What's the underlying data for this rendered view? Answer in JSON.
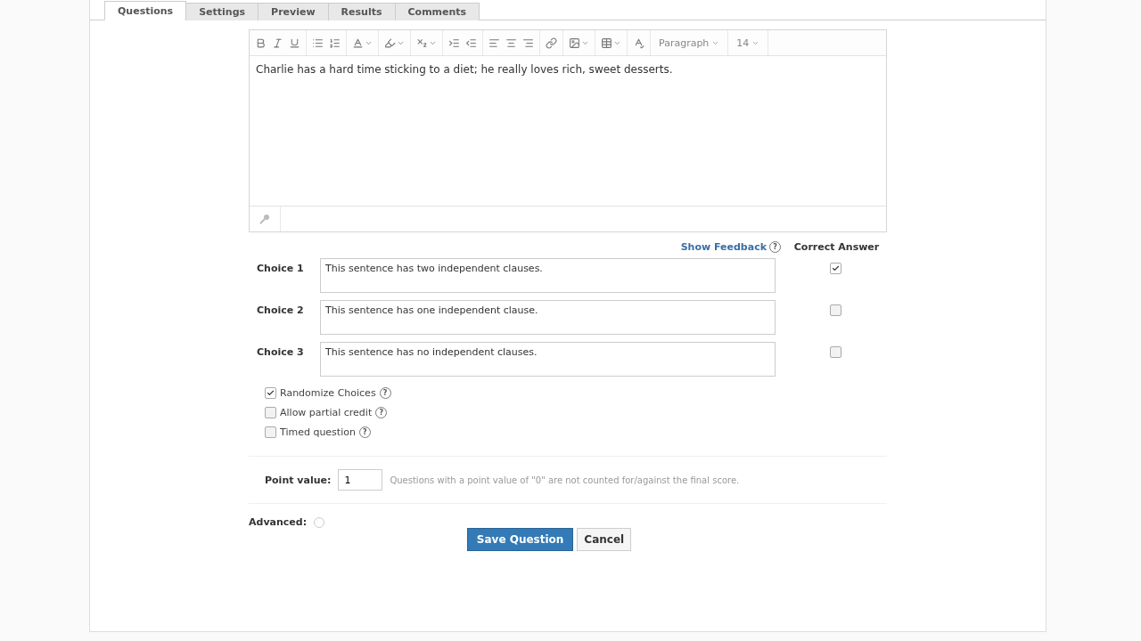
{
  "tabs": [
    {
      "label": "Questions",
      "selected": true
    },
    {
      "label": "Settings",
      "selected": false
    },
    {
      "label": "Preview",
      "selected": false
    },
    {
      "label": "Results",
      "selected": false
    },
    {
      "label": "Comments",
      "selected": false
    }
  ],
  "editor": {
    "format_dropdown": "Paragraph",
    "size_dropdown": "14",
    "content": "Charlie has a hard time sticking to a diet; he really loves rich, sweet desserts."
  },
  "show_feedback": "Show Feedback",
  "show_feedback_help": "?",
  "correct_answer_header": "Correct Answer",
  "choices": [
    {
      "label": "Choice 1",
      "value": "This sentence has two independent clauses.",
      "correct": true
    },
    {
      "label": "Choice 2",
      "value": "This sentence has one independent clause.",
      "correct": false
    },
    {
      "label": "Choice 3",
      "value": "This sentence has no independent clauses.",
      "correct": false
    }
  ],
  "options": [
    {
      "label": "Randomize Choices",
      "checked": true,
      "help": "?"
    },
    {
      "label": "Allow partial credit",
      "checked": false,
      "help": "?"
    },
    {
      "label": "Timed question",
      "checked": false,
      "help": "?"
    }
  ],
  "point_value": {
    "label": "Point value:",
    "value": "1",
    "hint": "Questions with a point value of \"0\" are not counted for/against the final score."
  },
  "advanced": {
    "label": "Advanced:"
  },
  "buttons": {
    "save": "Save Question",
    "cancel": "Cancel"
  }
}
